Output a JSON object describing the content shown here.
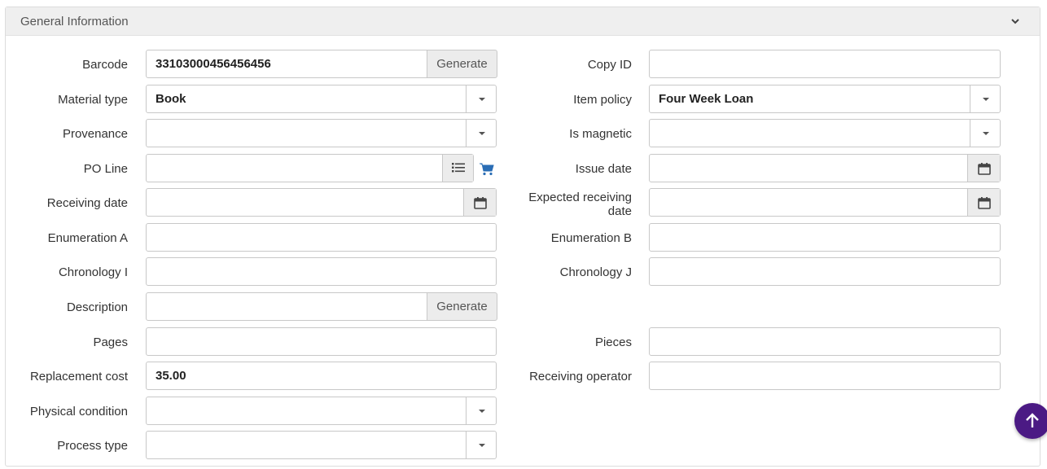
{
  "section": {
    "title": "General Information"
  },
  "left": {
    "barcode": {
      "label": "Barcode",
      "value": "33103000456456456",
      "button": "Generate"
    },
    "material_type": {
      "label": "Material type",
      "value": "Book"
    },
    "provenance": {
      "label": "Provenance",
      "value": ""
    },
    "po_line": {
      "label": "PO Line",
      "value": ""
    },
    "receiving_date": {
      "label": "Receiving date",
      "value": ""
    },
    "enumeration_a": {
      "label": "Enumeration A",
      "value": ""
    },
    "chronology_i": {
      "label": "Chronology I",
      "value": ""
    },
    "description": {
      "label": "Description",
      "value": "",
      "button": "Generate"
    },
    "pages": {
      "label": "Pages",
      "value": ""
    },
    "replacement_cost": {
      "label": "Replacement cost",
      "value": "35.00"
    },
    "physical_condition": {
      "label": "Physical condition",
      "value": ""
    },
    "process_type": {
      "label": "Process type",
      "value": ""
    }
  },
  "right": {
    "copy_id": {
      "label": "Copy ID",
      "value": ""
    },
    "item_policy": {
      "label": "Item policy",
      "value": "Four Week Loan"
    },
    "is_magnetic": {
      "label": "Is magnetic",
      "value": ""
    },
    "issue_date": {
      "label": "Issue date",
      "value": ""
    },
    "expected_receiving_date": {
      "label_line1": "Expected receiving",
      "label_line2": "date",
      "value": ""
    },
    "enumeration_b": {
      "label": "Enumeration B",
      "value": ""
    },
    "chronology_j": {
      "label": "Chronology J",
      "value": ""
    },
    "pieces": {
      "label": "Pieces",
      "value": ""
    },
    "receiving_operator": {
      "label": "Receiving operator",
      "value": ""
    }
  },
  "icons": {
    "collapse": "chevron-down-icon",
    "calendar": "calendar-icon",
    "list": "list-icon",
    "cart": "shopping-cart-icon",
    "scroll_top": "arrow-up-icon"
  },
  "colors": {
    "accent": "#2a6db5",
    "fab": "#4b1a84",
    "header_bg": "#efefef"
  }
}
